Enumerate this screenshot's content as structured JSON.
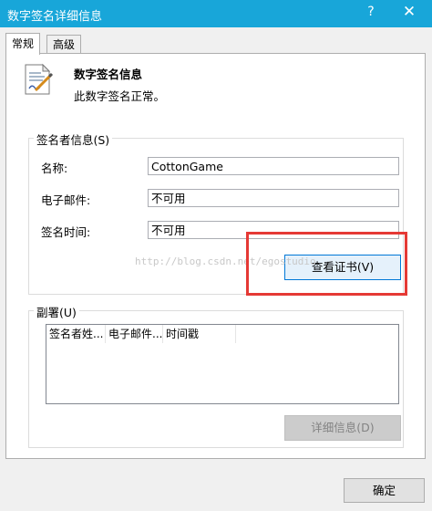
{
  "window": {
    "title": "数字签名详细信息",
    "help_label": "?",
    "close_label": "✕"
  },
  "tabs": [
    {
      "label": "常规",
      "active": true
    },
    {
      "label": "高级",
      "active": false
    }
  ],
  "info": {
    "icon": "certificate-icon",
    "title": "数字签名信息",
    "status": "此数字签名正常。"
  },
  "signer_group": {
    "legend": "签名者信息(S)",
    "fields": [
      {
        "label": "名称:",
        "value": "CottonGame"
      },
      {
        "label": "电子邮件:",
        "value": "不可用"
      },
      {
        "label": "签名时间:",
        "value": "不可用"
      }
    ],
    "view_cert_label": "查看证书(V)"
  },
  "countersignature_group": {
    "legend": "副署(U)",
    "columns": [
      "签名者姓...",
      "电子邮件...",
      "时间戳"
    ],
    "details_label": "详细信息(D)"
  },
  "ok_label": "确定",
  "watermark": "http://blog.csdn.net/egostudio",
  "colors": {
    "titlebar": "#18a6d9",
    "highlight": "#e53935",
    "button_focus_border": "#0078d7"
  }
}
